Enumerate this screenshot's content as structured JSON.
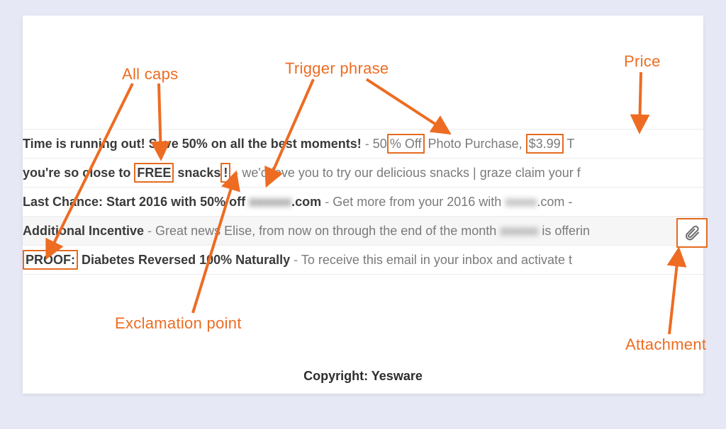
{
  "annotations": {
    "allcaps": "All caps",
    "trigger": "Trigger phrase",
    "price": "Price",
    "exclamation": "Exclamation point",
    "attachment": "Attachment"
  },
  "highlighted_values": {
    "free_word": "FREE",
    "exclamation_mark": "!",
    "pct_off": "% Off",
    "price_value": "$3.99",
    "proof_word": "PROOF:"
  },
  "rows": [
    {
      "subject_a": "Time is running out! Save 50% on all the best moments!",
      "sep": " - ",
      "preview_a": "50",
      "preview_b": " Photo Purchase, ",
      "preview_c": " T"
    },
    {
      "subject_a": "you're so close to ",
      "subject_b": " snacks",
      "sep": " - ",
      "preview_a": "we'd love you to try our delicious snacks | graze claim your f"
    },
    {
      "subject_a": "Last Chance: Start 2016 with 50% off ",
      "subject_blur": "xxxxxx",
      "subject_b": ".com",
      "sep": " - ",
      "preview_a": "Get more from your 2016 with ",
      "preview_blur": "xxxxx",
      "preview_b": ".com -"
    },
    {
      "subject_a": "Additional Incentive",
      "sep": " - ",
      "preview_a": "Great news Elise, from now on through the end of the month ",
      "preview_blur": "xxxxxx",
      "preview_b": " is offerin"
    },
    {
      "subject_a": " Diabetes Reversed 100% Naturally",
      "sep": " - ",
      "preview_a": "To receive this email in your inbox and activate t"
    }
  ],
  "copyright": "Copyright: Yesware"
}
